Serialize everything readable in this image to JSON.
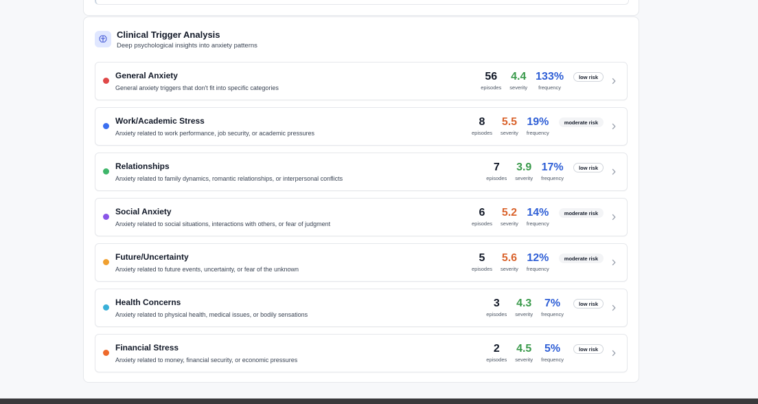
{
  "section": {
    "title": "Clinical Trigger Analysis",
    "subtitle": "Deep psychological insights into anxiety patterns",
    "icon": "brain-icon",
    "accent": "#4f63d9"
  },
  "colors": {
    "severity_low": "#3a9a4b",
    "severity_moderate": "#d9622b",
    "frequency": "#2f5fd6"
  },
  "labels": {
    "episodes": "episodes",
    "severity": "severity",
    "frequency": "frequency"
  },
  "triggers": [
    {
      "name": "General Anxiety",
      "description": "General anxiety triggers that don't fit into specific categories",
      "episodes": "56",
      "severity": "4.4",
      "frequency": "133%",
      "risk": "low risk",
      "level": "low",
      "dot": "#e04848"
    },
    {
      "name": "Work/Academic Stress",
      "description": "Anxiety related to work performance, job security, or academic pressures",
      "episodes": "8",
      "severity": "5.5",
      "frequency": "19%",
      "risk": "moderate risk",
      "level": "moderate",
      "dot": "#3b6ff0"
    },
    {
      "name": "Relationships",
      "description": "Anxiety related to family dynamics, romantic relationships, or interpersonal conflicts",
      "episodes": "7",
      "severity": "3.9",
      "frequency": "17%",
      "risk": "low risk",
      "level": "low",
      "dot": "#3fb66a"
    },
    {
      "name": "Social Anxiety",
      "description": "Anxiety related to social situations, interactions with others, or fear of judgment",
      "episodes": "6",
      "severity": "5.2",
      "frequency": "14%",
      "risk": "moderate risk",
      "level": "moderate",
      "dot": "#8a56e8"
    },
    {
      "name": "Future/Uncertainty",
      "description": "Anxiety related to future events, uncertainty, or fear of the unknown",
      "episodes": "5",
      "severity": "5.6",
      "frequency": "12%",
      "risk": "moderate risk",
      "level": "moderate",
      "dot": "#f0a030"
    },
    {
      "name": "Health Concerns",
      "description": "Anxiety related to physical health, medical issues, or bodily sensations",
      "episodes": "3",
      "severity": "4.3",
      "frequency": "7%",
      "risk": "low risk",
      "level": "low",
      "dot": "#3ab0d8"
    },
    {
      "name": "Financial Stress",
      "description": "Anxiety related to money, financial security, or economic pressures",
      "episodes": "2",
      "severity": "4.5",
      "frequency": "5%",
      "risk": "low risk",
      "level": "low",
      "dot": "#ee6a2c"
    }
  ]
}
